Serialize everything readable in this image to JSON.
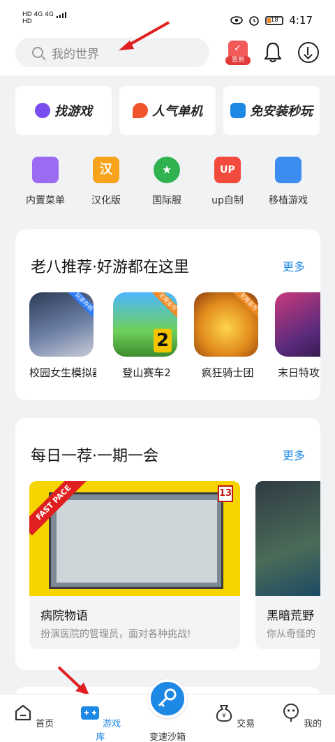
{
  "status_bar": {
    "left_line1": "HD 4G 4G",
    "left_line2": "HD",
    "battery": "18",
    "time": "4:17"
  },
  "search": {
    "placeholder": "我的世界"
  },
  "header": {
    "signin_label": "签到"
  },
  "categories": [
    {
      "label": "找游戏",
      "color": "#7a4df0"
    },
    {
      "label": "人气单机",
      "color": "#f0542b"
    },
    {
      "label": "免安装秒玩",
      "color": "#1e88e5"
    }
  ],
  "quick_links": [
    {
      "label": "内置菜单",
      "icon": "phone-menu-icon",
      "color": "#9b6cf2"
    },
    {
      "label": "汉化版",
      "icon": "chinese-hanzi-icon",
      "color": "#f7a31c"
    },
    {
      "label": "国际服",
      "icon": "globe-star-icon",
      "color": "#2fb24f"
    },
    {
      "label": "up自制",
      "icon": "up-badge-icon",
      "color": "#f24b3d"
    },
    {
      "label": "移植游戏",
      "icon": "monitor-icon",
      "color": "#3d8cf0"
    }
  ],
  "recommend": {
    "title": "老八推荐·好游都在这里",
    "more": "更多",
    "games": [
      {
        "name": "校园女生模拟器",
        "badge": "玩家存档"
      },
      {
        "name": "登山赛车2",
        "badge": "无限金币"
      },
      {
        "name": "疯狂骑士团",
        "badge": "无限金币"
      },
      {
        "name": "末日特攻",
        "badge": ""
      }
    ]
  },
  "daily": {
    "title": "每日一荐·一期一会",
    "more": "更多",
    "items": [
      {
        "title": "病院物语",
        "desc": "扮演医院的管理员，面对各种挑战!",
        "banner": "FAST PACE",
        "tag": "13"
      },
      {
        "title": "黑暗荒野",
        "desc": "你从奇怪的",
        "banner": "",
        "tag": ""
      }
    ]
  },
  "bottom_nav": [
    {
      "label": "首页",
      "icon": "home-icon"
    },
    {
      "label": "游戏库",
      "icon": "gamepad-icon"
    },
    {
      "label": "变速沙箱",
      "icon": "key-icon"
    },
    {
      "label": "交易",
      "icon": "money-bag-icon"
    },
    {
      "label": "我的",
      "icon": "profile-icon"
    }
  ]
}
